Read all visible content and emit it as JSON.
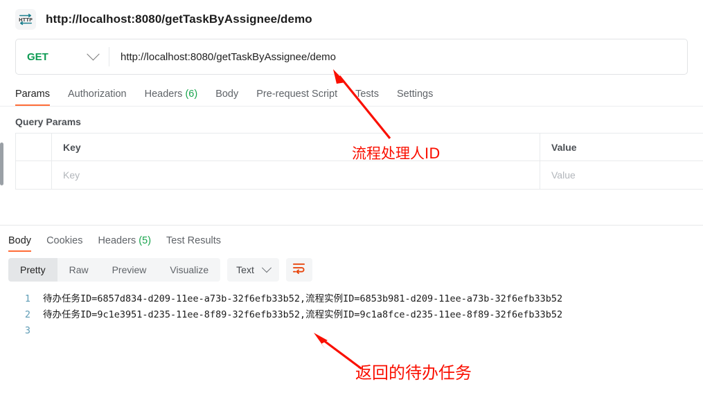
{
  "titlebar": {
    "icon": "http-protocol-icon",
    "icon_text": "HTTP",
    "title": "http://localhost:8080/getTaskByAssignee/demo"
  },
  "request": {
    "method": "GET",
    "method_color": "#0d9b53",
    "url": "http://localhost:8080/getTaskByAssignee/demo",
    "dropdown_icon": "chevron-down-icon",
    "tabs": [
      {
        "label": "Params",
        "active": true
      },
      {
        "label": "Authorization",
        "active": false
      },
      {
        "label": "Headers",
        "count": "(6)",
        "active": false
      },
      {
        "label": "Body",
        "active": false
      },
      {
        "label": "Pre-request Script",
        "active": false
      },
      {
        "label": "Tests",
        "active": false
      },
      {
        "label": "Settings",
        "active": false
      }
    ],
    "active_underline_color": "#ff6c37",
    "count_color": "#17a44c"
  },
  "query_params": {
    "section_title": "Query Params",
    "columns": [
      "Key",
      "Value"
    ],
    "rows": [
      {
        "key_placeholder": "Key",
        "value_placeholder": "Value"
      }
    ]
  },
  "response": {
    "tabs": [
      {
        "label": "Body",
        "active": true
      },
      {
        "label": "Cookies",
        "active": false
      },
      {
        "label": "Headers",
        "count": "(5)",
        "active": false
      },
      {
        "label": "Test Results",
        "active": false
      }
    ],
    "view_modes": [
      {
        "label": "Pretty",
        "active": true
      },
      {
        "label": "Raw",
        "active": false
      },
      {
        "label": "Preview",
        "active": false
      },
      {
        "label": "Visualize",
        "active": false
      }
    ],
    "format_select": {
      "value": "Text",
      "icon": "chevron-down-icon"
    },
    "wrap_button_icon": "word-wrap-icon",
    "wrap_icon_color": "#e8450c",
    "body_lines": [
      {
        "number": "1",
        "text": "待办任务ID=6857d834-d209-11ee-a73b-32f6efb33b52,流程实例ID=6853b981-d209-11ee-a73b-32f6efb33b52"
      },
      {
        "number": "2",
        "text": "待办任务ID=9c1e3951-d235-11ee-8f89-32f6efb33b52,流程实例ID=9c1a8fce-d235-11ee-8f89-32f6efb33b52"
      },
      {
        "number": "3",
        "text": ""
      }
    ]
  },
  "annotations": {
    "color": "#fa0f00",
    "items": [
      {
        "text": "流程处理人ID",
        "name": "annotation-url-path-param"
      },
      {
        "text": "返回的待办任务",
        "name": "annotation-returned-tasks"
      }
    ]
  }
}
